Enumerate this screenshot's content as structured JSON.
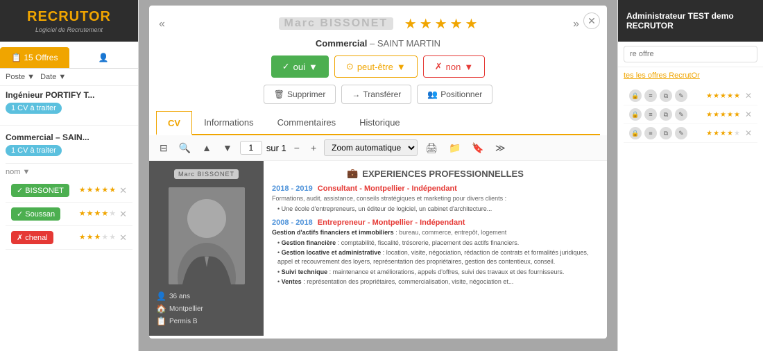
{
  "logo": {
    "text": "RECRUTOR",
    "subtitle": "Logiciel de Recrutement"
  },
  "sidebar": {
    "tab_offers": "15 Offres",
    "tab_icon": "👤",
    "filter_poste": "Poste ▼",
    "filter_date": "Date ▼",
    "candidate_title": "Ingénieur PORTIFY T...",
    "badge_cv": "1 CV à traiter",
    "name_label": "nom ▼",
    "candidates": [
      {
        "name": "BISSONET",
        "color": "green",
        "stars": 5
      },
      {
        "name": "Soussan",
        "color": "green",
        "stars": 4
      },
      {
        "name": "chenal",
        "color": "red",
        "stars": 3
      }
    ],
    "section2_title": "Commercial – SAIN...",
    "badge_cv2": "1 CV à traiter"
  },
  "right_sidebar": {
    "header": "Administrateur TEST demo RECRUTOR",
    "search_placeholder": "re offre",
    "link": "tes les offres RecrutOr",
    "offers": [
      {
        "stars": 5,
        "filled": 5
      },
      {
        "stars": 5,
        "filled": 5
      },
      {
        "stars": 4,
        "filled": 4
      }
    ]
  },
  "modal": {
    "candidate_name": "Marc BISSONET",
    "nav_prev": "«",
    "nav_next": "»",
    "stars": 5,
    "subtitle_role": "Commercial",
    "subtitle_location": "SAINT MARTIN",
    "btn_oui": "✓ oui ▼",
    "btn_peut_etre": "⊙ peut-être ▼",
    "btn_non": "✗ non ▼",
    "btn_supprimer": "Supprimer",
    "btn_transferer": "Transférer",
    "btn_positionner": "Positionner",
    "tabs": [
      "CV",
      "Informations",
      "Commentaires",
      "Historique"
    ],
    "active_tab": 0,
    "cv_toolbar": {
      "page_current": "1",
      "page_total": "sur 1",
      "zoom": "Zoom automatique"
    },
    "cv_content": {
      "photo_alt": "Photo candidate",
      "info_age": "36 ans",
      "info_city": "Montpellier",
      "info_permis": "Permis B",
      "section_title": "EXPERIENCES PROFESSIONNELLES",
      "experiences": [
        {
          "years": "2018 - 2019",
          "title": "Consultant - Montpellier - Indépendant",
          "desc": "Formations, audit, assistance, conseils stratégiques et marketing pour divers clients :",
          "bullets": [
            "Une école d'entrepreneurs, un éditeur de logiciel, un cabinet d'architecture..."
          ]
        },
        {
          "years": "2008 - 2018",
          "title": "Entrepreneur - Montpellier - Indépendant",
          "desc": "Gestion d'actifs financiers et immobiliers : bureau, commerce, entrepôt, logement",
          "bullets": [
            "Gestion financière : comptabilité, fiscalité, trésorerie, placement des actifs financiers.",
            "Gestion locative et administrative : location, visite, négociation, rédaction de contrats et formalités juridiques, appel et recouvrement des loyers, représentation des propriétaires, gestion des contentieux, conseil.",
            "Suivi technique : maintenance et améliorations, appels d'offres, suivi des travaux et des fournisseurs.",
            "Ventes : représentation des propriétaires, commercialisation, visite, négociation et..."
          ]
        }
      ]
    }
  }
}
